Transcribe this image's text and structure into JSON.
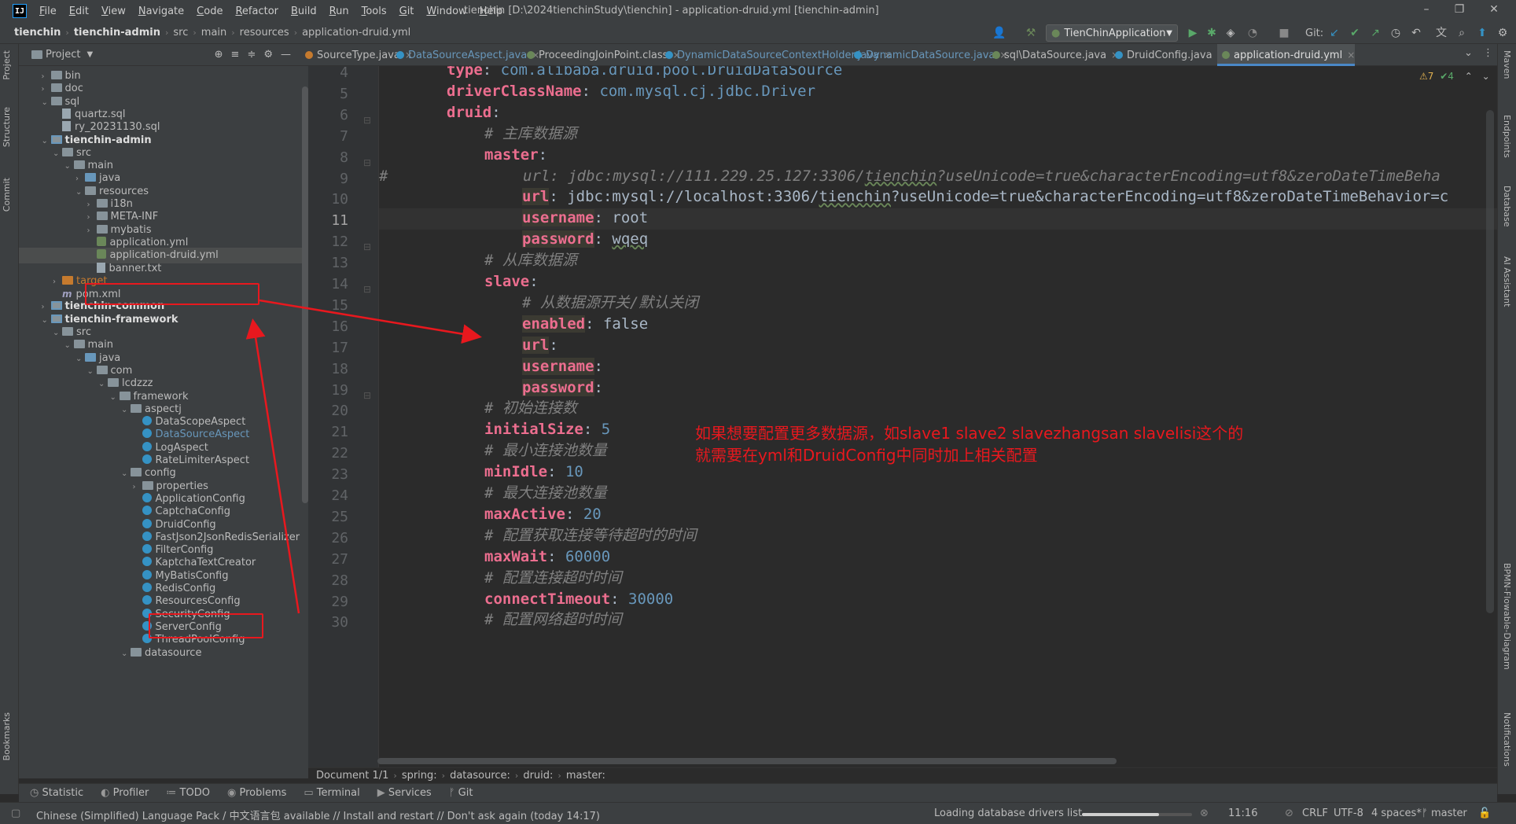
{
  "window": {
    "title": "tienchin [D:\\2024tienchinStudy\\tienchin] - application-druid.yml [tienchin-admin]",
    "logo": "IJ",
    "minimize": "–",
    "maximize": "❐",
    "close": "✕"
  },
  "menu": [
    "File",
    "Edit",
    "View",
    "Navigate",
    "Code",
    "Refactor",
    "Build",
    "Run",
    "Tools",
    "Git",
    "Window",
    "Help"
  ],
  "breadcrumb": [
    "tienchin",
    "tienchin-admin",
    "src",
    "main",
    "resources",
    "application-druid.yml"
  ],
  "toolbar": {
    "run_config": "TienChinApplication",
    "git_label": "Git:"
  },
  "project_panel": {
    "title": "Project",
    "tree": [
      {
        "label": "bin",
        "depth": 1,
        "kind": "folder",
        "arrow": ">"
      },
      {
        "label": "doc",
        "depth": 1,
        "kind": "folder",
        "arrow": ">"
      },
      {
        "label": "sql",
        "depth": 1,
        "kind": "folder",
        "arrow": "v"
      },
      {
        "label": "quartz.sql",
        "depth": 2,
        "kind": "file"
      },
      {
        "label": "ry_20231130.sql",
        "depth": 2,
        "kind": "file"
      },
      {
        "label": "tienchin-admin",
        "depth": 1,
        "kind": "module",
        "arrow": "v",
        "bold": true
      },
      {
        "label": "src",
        "depth": 2,
        "kind": "folder",
        "arrow": "v"
      },
      {
        "label": "main",
        "depth": 3,
        "kind": "folder",
        "arrow": "v"
      },
      {
        "label": "java",
        "depth": 4,
        "kind": "folder-blue",
        "arrow": ">"
      },
      {
        "label": "resources",
        "depth": 4,
        "kind": "folder",
        "arrow": "v"
      },
      {
        "label": "i18n",
        "depth": 5,
        "kind": "folder",
        "arrow": ">"
      },
      {
        "label": "META-INF",
        "depth": 5,
        "kind": "folder",
        "arrow": ">"
      },
      {
        "label": "mybatis",
        "depth": 5,
        "kind": "folder",
        "arrow": ">"
      },
      {
        "label": "application.yml",
        "depth": 5,
        "kind": "yml"
      },
      {
        "label": "application-druid.yml",
        "depth": 5,
        "kind": "yml",
        "selected": true
      },
      {
        "label": "banner.txt",
        "depth": 5,
        "kind": "file"
      },
      {
        "label": "target",
        "depth": 2,
        "kind": "folder-orange",
        "arrow": ">",
        "muted": true
      },
      {
        "label": "pom.xml",
        "depth": 2,
        "kind": "maven"
      },
      {
        "label": "tienchin-common",
        "depth": 1,
        "kind": "module",
        "arrow": ">",
        "bold": true
      },
      {
        "label": "tienchin-framework",
        "depth": 1,
        "kind": "module",
        "arrow": "v",
        "bold": true
      },
      {
        "label": "src",
        "depth": 2,
        "kind": "folder",
        "arrow": "v"
      },
      {
        "label": "main",
        "depth": 3,
        "kind": "folder",
        "arrow": "v"
      },
      {
        "label": "java",
        "depth": 4,
        "kind": "folder-blue",
        "arrow": "v"
      },
      {
        "label": "com",
        "depth": 5,
        "kind": "folder",
        "arrow": "v"
      },
      {
        "label": "lcdzzz",
        "depth": 6,
        "kind": "folder",
        "arrow": "v"
      },
      {
        "label": "framework",
        "depth": 7,
        "kind": "folder",
        "arrow": "v"
      },
      {
        "label": "aspectj",
        "depth": 8,
        "kind": "folder",
        "arrow": "v"
      },
      {
        "label": "DataScopeAspect",
        "depth": 9,
        "kind": "class"
      },
      {
        "label": "DataSourceAspect",
        "depth": 9,
        "kind": "class",
        "highlight": true
      },
      {
        "label": "LogAspect",
        "depth": 9,
        "kind": "class"
      },
      {
        "label": "RateLimiterAspect",
        "depth": 9,
        "kind": "class"
      },
      {
        "label": "config",
        "depth": 8,
        "kind": "folder",
        "arrow": "v"
      },
      {
        "label": "properties",
        "depth": 9,
        "kind": "folder",
        "arrow": ">"
      },
      {
        "label": "ApplicationConfig",
        "depth": 9,
        "kind": "class"
      },
      {
        "label": "CaptchaConfig",
        "depth": 9,
        "kind": "class"
      },
      {
        "label": "DruidConfig",
        "depth": 9,
        "kind": "class"
      },
      {
        "label": "FastJson2JsonRedisSerializer",
        "depth": 9,
        "kind": "class"
      },
      {
        "label": "FilterConfig",
        "depth": 9,
        "kind": "class"
      },
      {
        "label": "KaptchaTextCreator",
        "depth": 9,
        "kind": "class"
      },
      {
        "label": "MyBatisConfig",
        "depth": 9,
        "kind": "class"
      },
      {
        "label": "RedisConfig",
        "depth": 9,
        "kind": "class"
      },
      {
        "label": "ResourcesConfig",
        "depth": 9,
        "kind": "class"
      },
      {
        "label": "SecurityConfig",
        "depth": 9,
        "kind": "class"
      },
      {
        "label": "ServerConfig",
        "depth": 9,
        "kind": "class"
      },
      {
        "label": "ThreadPoolConfig",
        "depth": 9,
        "kind": "class"
      },
      {
        "label": "datasource",
        "depth": 8,
        "kind": "folder",
        "arrow": "v"
      }
    ]
  },
  "tabs": [
    {
      "label": "SourceType.java",
      "color": "#c57a2e"
    },
    {
      "label": "DataSourceAspect.java",
      "color": "#3592c4"
    },
    {
      "label": "ProceedingJoinPoint.class",
      "color": "#6a8759"
    },
    {
      "label": "DynamicDataSourceContextHolder.java",
      "color": "#3592c4"
    },
    {
      "label": "DynamicDataSource.java",
      "color": "#3592c4"
    },
    {
      "label": "sql\\DataSource.java",
      "color": "#6a8759"
    },
    {
      "label": "DruidConfig.java",
      "color": "#3592c4"
    },
    {
      "label": "application-druid.yml",
      "color": "#6a8759",
      "active": true
    }
  ],
  "editor": {
    "warnings": "⚠7",
    "checks": "✔4",
    "lines": [
      {
        "n": "4",
        "indent": 3,
        "tokens": [
          [
            "k",
            "type"
          ],
          [
            "val",
            ": "
          ],
          [
            "cls",
            "com.alibaba.druid.pool.DruidDataSource"
          ]
        ]
      },
      {
        "n": "5",
        "indent": 3,
        "tokens": [
          [
            "k",
            "driverClassName"
          ],
          [
            "val",
            ": "
          ],
          [
            "cls",
            "com.mysql.cj.jdbc.Driver"
          ]
        ]
      },
      {
        "n": "6",
        "indent": 3,
        "tokens": [
          [
            "k",
            "druid"
          ],
          [
            "val",
            ":"
          ]
        ]
      },
      {
        "n": "7",
        "indent": 4,
        "tokens": [
          [
            "cmtg",
            "# 主库数据源"
          ]
        ]
      },
      {
        "n": "8",
        "indent": 4,
        "tokens": [
          [
            "k",
            "master"
          ],
          [
            "val",
            ":"
          ]
        ]
      },
      {
        "n": "9",
        "indent": 0,
        "tokens": [
          [
            "cmtg",
            "#               url: jdbc:mysql://111.229.25.127:3306/"
          ],
          [
            "cmtu",
            "tienchin"
          ],
          [
            "cmtg",
            "?useUnicode=true&characterEncoding=utf8&zeroDateTimeBeha"
          ]
        ]
      },
      {
        "n": "10",
        "indent": 5,
        "tokens": [
          [
            "kw",
            "url"
          ],
          [
            "val",
            ": jdbc:mysql://localhost:3306/"
          ],
          [
            "valu",
            "tienchin"
          ],
          [
            "val",
            "?useUnicode=true&characterEncoding=utf8&zeroDateTimeBehavior=c"
          ]
        ]
      },
      {
        "n": "11",
        "indent": 5,
        "tokens": [
          [
            "kw",
            "username"
          ],
          [
            "val",
            ": root"
          ]
        ],
        "current": true
      },
      {
        "n": "12",
        "indent": 5,
        "tokens": [
          [
            "kw",
            "password"
          ],
          [
            "val",
            ": "
          ],
          [
            "valu",
            "wqeq"
          ]
        ]
      },
      {
        "n": "13",
        "indent": 4,
        "tokens": [
          [
            "cmtg",
            "# 从库数据源"
          ]
        ]
      },
      {
        "n": "14",
        "indent": 4,
        "tokens": [
          [
            "k",
            "slave"
          ],
          [
            "val",
            ":"
          ]
        ]
      },
      {
        "n": "15",
        "indent": 5,
        "tokens": [
          [
            "cmtg",
            "# 从数据源开关/默认关闭"
          ]
        ]
      },
      {
        "n": "16",
        "indent": 5,
        "tokens": [
          [
            "kw",
            "enabled"
          ],
          [
            "val",
            ": false"
          ]
        ]
      },
      {
        "n": "17",
        "indent": 5,
        "tokens": [
          [
            "kw",
            "url"
          ],
          [
            "val",
            ":"
          ]
        ]
      },
      {
        "n": "18",
        "indent": 5,
        "tokens": [
          [
            "kw",
            "username"
          ],
          [
            "val",
            ":"
          ]
        ]
      },
      {
        "n": "19",
        "indent": 5,
        "tokens": [
          [
            "kw",
            "password"
          ],
          [
            "val",
            ":"
          ]
        ]
      },
      {
        "n": "20",
        "indent": 4,
        "tokens": [
          [
            "cmtg",
            "# 初始连接数"
          ]
        ]
      },
      {
        "n": "21",
        "indent": 4,
        "tokens": [
          [
            "k",
            "initialSize"
          ],
          [
            "val",
            ": "
          ],
          [
            "num",
            "5"
          ]
        ]
      },
      {
        "n": "22",
        "indent": 4,
        "tokens": [
          [
            "cmtg",
            "# 最小连接池数量"
          ]
        ]
      },
      {
        "n": "23",
        "indent": 4,
        "tokens": [
          [
            "k",
            "minIdle"
          ],
          [
            "val",
            ": "
          ],
          [
            "num",
            "10"
          ]
        ]
      },
      {
        "n": "24",
        "indent": 4,
        "tokens": [
          [
            "cmtg",
            "# 最大连接池数量"
          ]
        ]
      },
      {
        "n": "25",
        "indent": 4,
        "tokens": [
          [
            "k",
            "maxActive"
          ],
          [
            "val",
            ": "
          ],
          [
            "num",
            "20"
          ]
        ]
      },
      {
        "n": "26",
        "indent": 4,
        "tokens": [
          [
            "cmtg",
            "# 配置获取连接等待超时的时间"
          ]
        ]
      },
      {
        "n": "27",
        "indent": 4,
        "tokens": [
          [
            "k",
            "maxWait"
          ],
          [
            "val",
            ": "
          ],
          [
            "num",
            "60000"
          ]
        ]
      },
      {
        "n": "28",
        "indent": 4,
        "tokens": [
          [
            "cmtg",
            "# 配置连接超时时间"
          ]
        ]
      },
      {
        "n": "29",
        "indent": 4,
        "tokens": [
          [
            "k",
            "connectTimeout"
          ],
          [
            "val",
            ": "
          ],
          [
            "num",
            "30000"
          ]
        ]
      },
      {
        "n": "30",
        "indent": 4,
        "tokens": [
          [
            "cmtg",
            "# 配置网络超时时间"
          ]
        ]
      }
    ]
  },
  "annotation": {
    "line1": "如果想要配置更多数据源，如slave1 slave2 slavezhangsan slavelisi这个的",
    "line2": "就需要在yml和DruidConfig中同时加上相关配置"
  },
  "code_breadcrumb": [
    "Document 1/1",
    "spring:",
    "datasource:",
    "druid:",
    "master:"
  ],
  "tool_windows": [
    "Statistic",
    "Profiler",
    "TODO",
    "Problems",
    "Terminal",
    "Services",
    "Git"
  ],
  "left_strip": [
    "Project",
    "Structure",
    "Commit",
    "Bookmarks"
  ],
  "right_strip": [
    "Maven",
    "Endpoints",
    "Database",
    "AI Assistant",
    "BPMN-Flowable-Diagram",
    "Notifications"
  ],
  "status": {
    "message": "Chinese (Simplified) Language Pack / 中文语言包 available // Install and restart // Don't ask again (today 14:17)",
    "loading": "Loading database drivers list...",
    "position": "11:16",
    "line_sep": "CRLF",
    "encoding": "UTF-8",
    "indent": "4 spaces*",
    "branch": "master"
  },
  "colors": {
    "accent": "#4a88c7",
    "annotation_red": "#e8181e"
  }
}
